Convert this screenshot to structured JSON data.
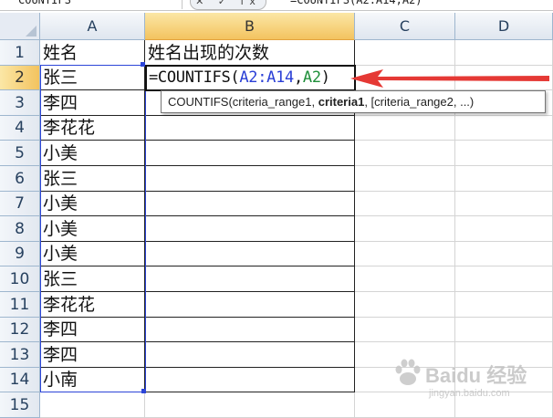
{
  "formula_bar": {
    "name_box": "COUNTIFS",
    "fx_buttons": "✕ ✓ fx",
    "content": "=COUNTIFS(A2:A14,A2)"
  },
  "columns": [
    "A",
    "B",
    "C",
    "D"
  ],
  "rows": [
    "1",
    "2",
    "3",
    "4",
    "5",
    "6",
    "7",
    "8",
    "9",
    "10",
    "11",
    "12",
    "13",
    "14",
    "15"
  ],
  "cells": {
    "A": [
      "姓名",
      "张三",
      "李四",
      "李花花",
      "小美",
      "张三",
      "小美",
      "小美",
      "小美",
      "张三",
      "李花花",
      "李四",
      "李四",
      "小南",
      ""
    ],
    "B1": "姓名出现的次数"
  },
  "active_cell": {
    "formula_start": "=COUNTIFS(",
    "range_ref": "A2:A14",
    "separator": ",",
    "criteria_ref": "A2",
    "formula_end": ")"
  },
  "tooltip": {
    "before": "COUNTIFS(criteria_range1, ",
    "bold": "criteria1",
    "after": ", [criteria_range2, ...)"
  },
  "colors": {
    "arrow": "#e53935",
    "range_border": "#2c45d8",
    "selected_header": "#f3c35f"
  },
  "watermark": {
    "main": "Baidu 经验",
    "sub": "jingyan.baidu.com"
  }
}
